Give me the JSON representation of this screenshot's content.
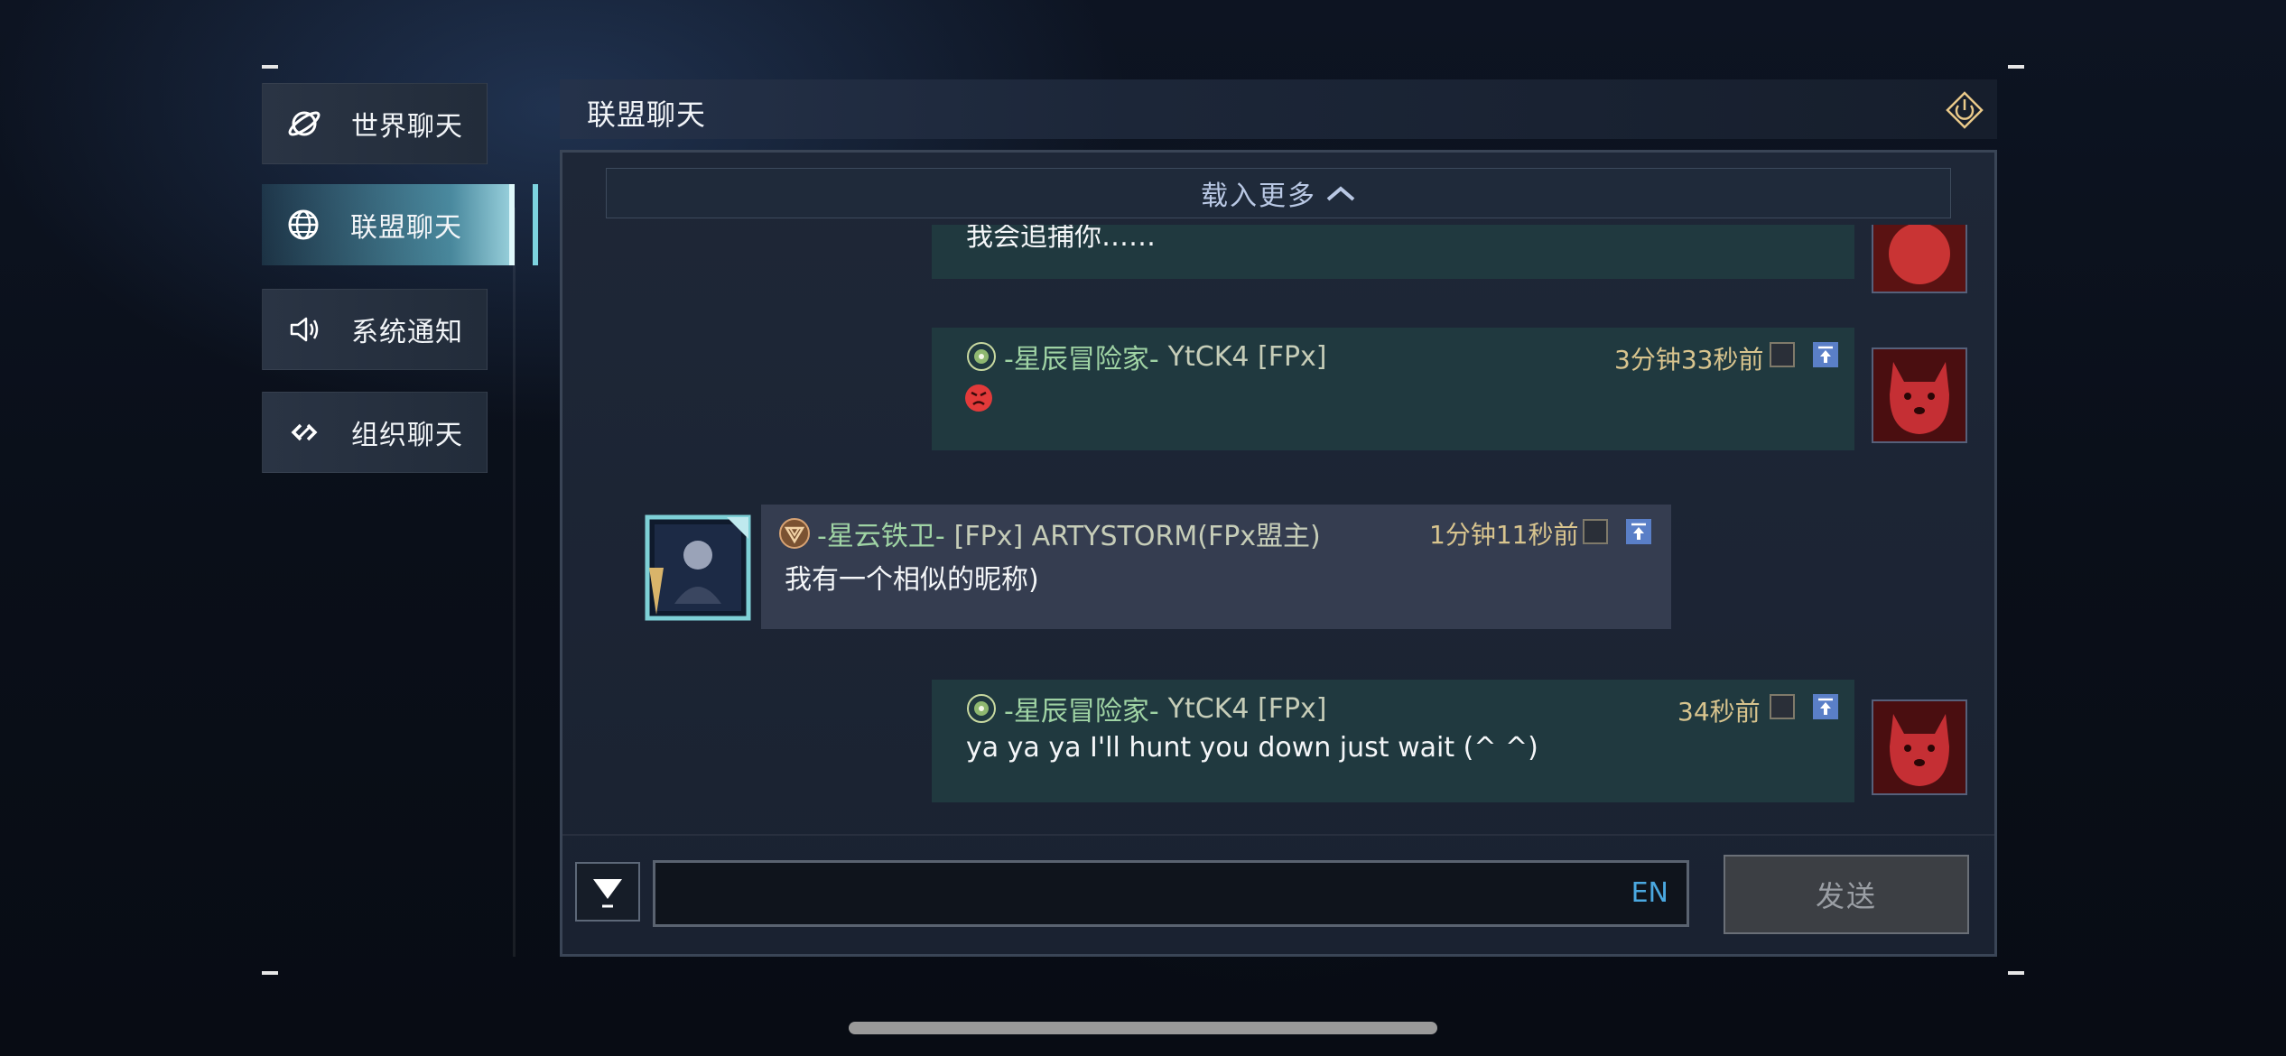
{
  "sidebar": {
    "items": [
      {
        "label": "世界聊天",
        "icon": "planet-icon"
      },
      {
        "label": "联盟聊天",
        "icon": "globe-icon",
        "active": true
      },
      {
        "label": "系统通知",
        "icon": "speaker-icon"
      },
      {
        "label": "组织聊天",
        "icon": "link-icon"
      }
    ]
  },
  "header": {
    "title": "联盟聊天",
    "exit_icon": "exit-icon"
  },
  "chat": {
    "load_more": "载入更多",
    "messages": [
      {
        "side": "self",
        "text": "我会追捕你……"
      },
      {
        "side": "self",
        "title": "-星辰冒险家-",
        "name": "YtCK4 [FPx]",
        "time": "3分钟33秒前",
        "content": "angry-emoji"
      },
      {
        "side": "other",
        "title": "-星云铁卫-",
        "name": "[FPx] ARTYSTORM(FPx盟主)",
        "time": "1分钟11秒前",
        "text": "我有一个相似的昵称)"
      },
      {
        "side": "self",
        "title": "-星辰冒险家-",
        "name": "YtCK4 [FPx]",
        "time": "34秒前",
        "text": "ya ya ya I'll hunt you down just wait (^ ^)"
      }
    ]
  },
  "input": {
    "placeholder": "",
    "lang": "EN",
    "send_label": "发送"
  },
  "colors": {
    "self_bubble": "#20393f",
    "other_bubble": "#353d50",
    "title_green": "#9fd3a4",
    "time_gold": "#d8c48e",
    "lang_blue": "#4aa8e0"
  }
}
